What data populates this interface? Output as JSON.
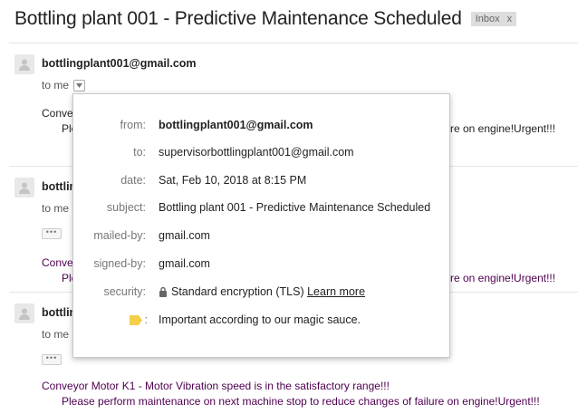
{
  "thread": {
    "subject": "Bottling plant 001 - Predictive Maintenance Scheduled",
    "label": "Inbox",
    "label_close": "x"
  },
  "messages": [
    {
      "sender": "bottlingplant001@gmail.com",
      "to": "to me",
      "preview_start": "Conveyor",
      "preview_start_2": "Ple",
      "preview_end": "re on engine!Urgent!!!"
    },
    {
      "sender_partial": "bottlin",
      "to": "to me",
      "ellipsis": "•••",
      "preview_start": "Conveyor",
      "preview_start_2": "Ple",
      "preview_end": "re on engine!Urgent!!!"
    },
    {
      "sender_partial": "bottlin",
      "to": "to me",
      "ellipsis": "•••",
      "body_line1": "Conveyor Motor K1 - Motor Vibration speed is in the satisfactory range!!!",
      "body_line2": "Please perform maintenance on next machine stop to reduce changes of failure on engine!Urgent!!!"
    }
  ],
  "details_popup": {
    "rows": [
      {
        "label": "from:",
        "value": "bottlingplant001@gmail.com"
      },
      {
        "label": "to:",
        "value": "supervisorbottlingplant001@gmail.com"
      },
      {
        "label": "date:",
        "value": "Sat, Feb 10, 2018 at 8:15 PM"
      },
      {
        "label": "subject:",
        "value": "Bottling plant 001 - Predictive Maintenance Scheduled"
      },
      {
        "label": "mailed-by:",
        "value": "gmail.com"
      },
      {
        "label": "signed-by:",
        "value": "gmail.com"
      },
      {
        "label": "security:",
        "value": "Standard encryption (TLS)",
        "link": "Learn more"
      }
    ],
    "importance_label": ":",
    "importance_text": "Important according to our magic sauce.",
    "importance_color": "#f4d049"
  },
  "colors": {
    "body_text": "#500050",
    "label_chip_bg": "#dddddd"
  }
}
